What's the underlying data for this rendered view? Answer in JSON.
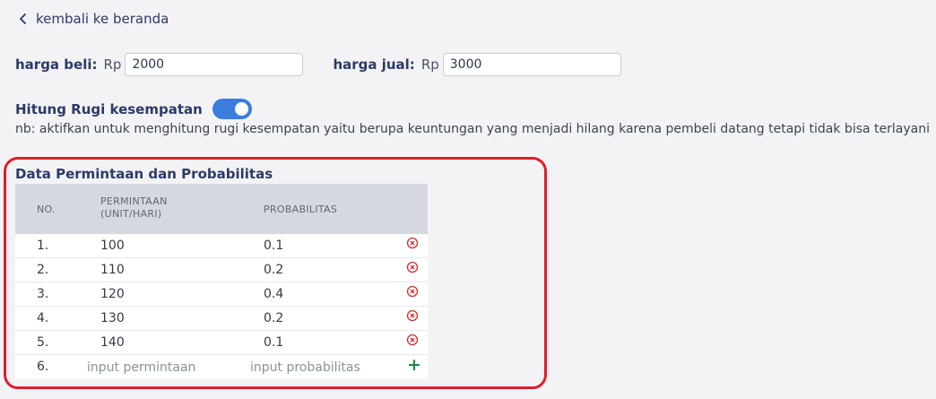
{
  "nav": {
    "back_label": "kembali ke beranda"
  },
  "prices": {
    "buy_label": "harga beli:",
    "sell_label": "harga jual:",
    "currency": "Rp",
    "buy_value": "2000",
    "sell_value": "3000"
  },
  "opportunity_loss": {
    "label": "Hitung Rugi kesempatan",
    "enabled": true,
    "note": "nb: aktifkan untuk menghitung rugi kesempatan yaitu berupa keuntungan yang menjadi hilang karena pembeli datang tetapi tidak bisa terlayani"
  },
  "table": {
    "title": "Data Permintaan dan Probabilitas",
    "headers": {
      "no": "NO.",
      "demand_line1": "PERMINTAAN",
      "demand_line2": "(UNIT/HARI)",
      "probability": "PROBABILITAS"
    },
    "rows": [
      {
        "no": "1.",
        "demand": "100",
        "probability": "0.1"
      },
      {
        "no": "2.",
        "demand": "110",
        "probability": "0.2"
      },
      {
        "no": "3.",
        "demand": "120",
        "probability": "0.4"
      },
      {
        "no": "4.",
        "demand": "130",
        "probability": "0.2"
      },
      {
        "no": "5.",
        "demand": "140",
        "probability": "0.1"
      }
    ],
    "new_row": {
      "no": "6.",
      "demand_placeholder": "input permintaan",
      "probability_placeholder": "input probabilitas",
      "add_symbol": "+"
    }
  },
  "colors": {
    "accent": "#3b7ddd",
    "delete": "#d32f2f",
    "add": "#1f8a4c",
    "highlight": "#e11d2a"
  },
  "icons": {
    "back": "chevron-left-icon",
    "delete": "circle-x-icon",
    "add": "plus-icon"
  }
}
